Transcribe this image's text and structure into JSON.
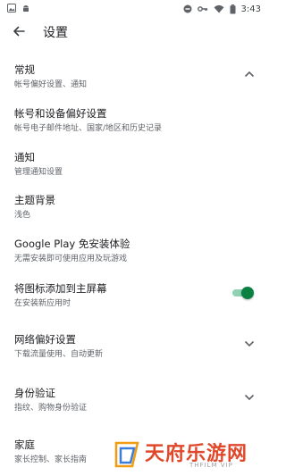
{
  "status_bar": {
    "time": "3:43",
    "left_icons": [
      "photo-icon",
      "android-icon"
    ],
    "right_icons": [
      "dnd-icon",
      "key-icon",
      "wifi-icon",
      "battery-icon"
    ]
  },
  "toolbar": {
    "back_icon": "arrow-back-icon",
    "title": "设置"
  },
  "settings": [
    {
      "title": "常规",
      "subtitle": "帐号偏好设置、通知",
      "control": "chevron-up"
    },
    {
      "title": "帐号和设备偏好设置",
      "subtitle": "帐号电子邮件地址、国家/地区和历史记录",
      "control": "none"
    },
    {
      "title": "通知",
      "subtitle": "管理通知设置",
      "control": "none"
    },
    {
      "title": "主题背景",
      "subtitle": "浅色",
      "control": "none"
    },
    {
      "title": "Google Play 免安装体验",
      "subtitle": "无需安装即可使用应用及玩游戏",
      "control": "none"
    },
    {
      "title": "将图标添加到主屏幕",
      "subtitle": "在安装新应用时",
      "control": "toggle",
      "toggle_on": true
    },
    {
      "title": "网络偏好设置",
      "subtitle": "下载流量使用、自动更新",
      "control": "chevron-down"
    },
    {
      "title": "身份验证",
      "subtitle": "指纹、购物身份验证",
      "control": "chevron-down"
    },
    {
      "title": "家庭",
      "subtitle": "家长控制、家长指南",
      "control": "none"
    }
  ],
  "watermark": {
    "text": "天府乐游网",
    "sub": "THFILM VIP"
  },
  "colors": {
    "accent": "#0b8043",
    "text_primary": "#202124",
    "text_secondary": "#5f6368",
    "watermark": "#e0482c"
  }
}
